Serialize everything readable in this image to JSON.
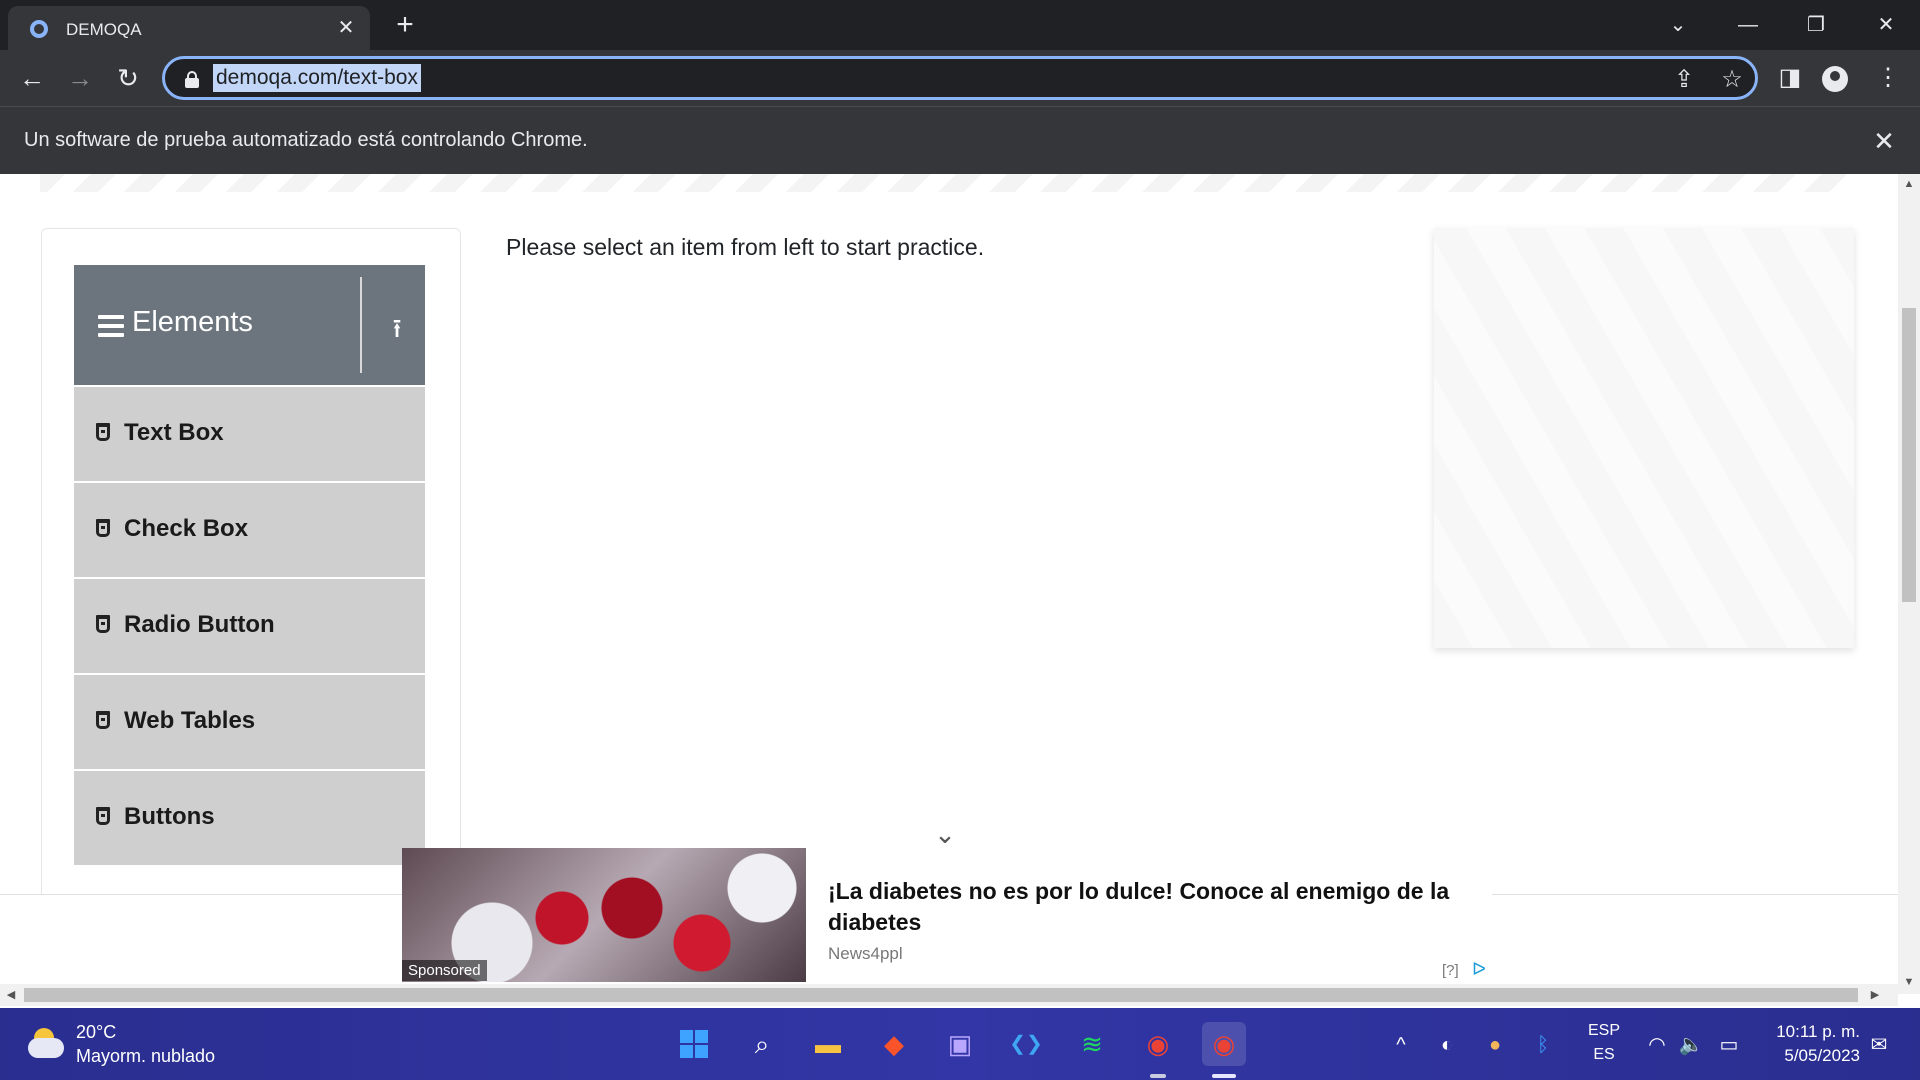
{
  "browser": {
    "tab_title": "DEMOQA",
    "tab_close": "✕",
    "new_tab": "+",
    "url": "demoqa.com/text-box",
    "infobar_text": "Un software de prueba automatizado está controlando Chrome.",
    "infobar_close": "✕",
    "icons": {
      "back": "←",
      "forward": "→",
      "reload": "↻",
      "share": "⇪",
      "star": "☆",
      "sidebar": "◨",
      "menu": "⋮",
      "tab_search": "⌄",
      "minimize": "—",
      "restore": "❐",
      "close": "✕"
    }
  },
  "sidebar": {
    "group_title": "Elements",
    "collapse_icon": "⭱",
    "items": [
      {
        "label": "Text Box"
      },
      {
        "label": "Check Box"
      },
      {
        "label": "Radio Button"
      },
      {
        "label": "Web Tables"
      },
      {
        "label": "Buttons"
      }
    ]
  },
  "main": {
    "practice_text": "Please select an item from left to start practice."
  },
  "ad": {
    "chevron": "⌄",
    "sponsored_label": "Sponsored",
    "headline": "¡La diabetes no es por lo dulce! Conoce al enemigo de la diabetes",
    "source": "News4ppl",
    "badge": "[?]",
    "choices_icon": "ᐅ"
  },
  "taskbar": {
    "weather_temp": "20°C",
    "weather_desc": "Mayorm. nublado",
    "apps": [
      "start",
      "search",
      "file-explorer",
      "brave",
      "app",
      "vscode",
      "spotify",
      "chrome",
      "chrome-active"
    ],
    "app_glyphs": {
      "search": "⌕",
      "file_explorer": "▬",
      "brave": "◆",
      "app": "▣",
      "vscode": "❮❯",
      "spotify": "≋",
      "chrome": "◉"
    },
    "tray": {
      "chevron": "^",
      "obs": "◐",
      "weather": "●",
      "bluetooth": "ᛒ",
      "wifi": "◠",
      "volume": "🔈",
      "battery": "▭",
      "notifications": "✉"
    },
    "lang_top": "ESP",
    "lang_bottom": "ES",
    "time": "10:11 p. m.",
    "date": "5/05/2023"
  },
  "colors": {
    "accent": "#8ab4f8",
    "sidebar_header": "#6c757d",
    "sidebar_item": "#cfcfcf",
    "taskbar": "#2b2fa0"
  }
}
